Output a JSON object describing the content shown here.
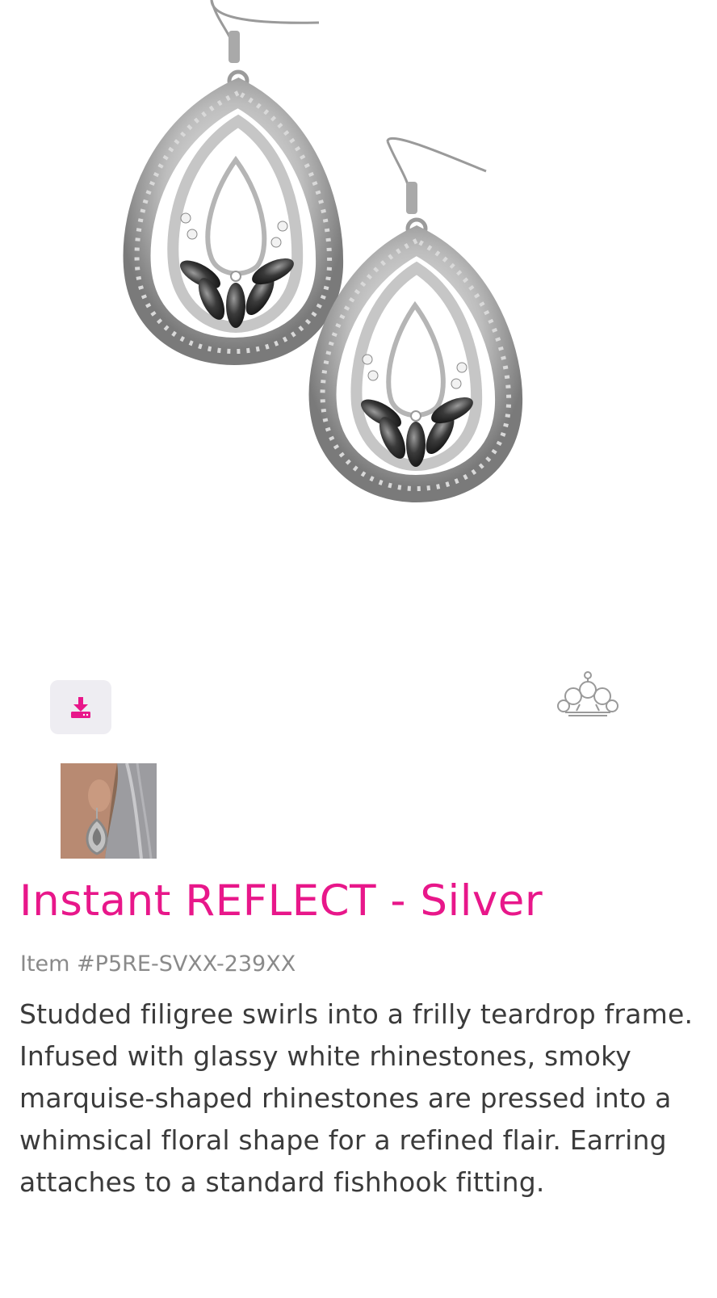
{
  "hero": {
    "image": "silver-teardrop-earrings-photo"
  },
  "actions": {
    "download_icon": "download-icon"
  },
  "brand": {
    "logo_icon": "paparazzi-crown-logo"
  },
  "gallery": {
    "thumbnail": "model-wearing-earring-thumbnail"
  },
  "product": {
    "title": "Instant REFLECT - Silver",
    "item_number": "Item #P5RE-SVXX-239XX",
    "description": "Studded filigree swirls into a frilly teardrop frame. Infused with glassy white rhinestones, smoky marquise-shaped rhinestones are pressed into a whimsical floral shape for a refined flair. Earring attaches to a standard fishhook fitting."
  },
  "colors": {
    "accent": "#e8178a",
    "button_bg": "#eeedf2",
    "text": "#3b3b3b",
    "muted_text": "#8a8a8a"
  }
}
